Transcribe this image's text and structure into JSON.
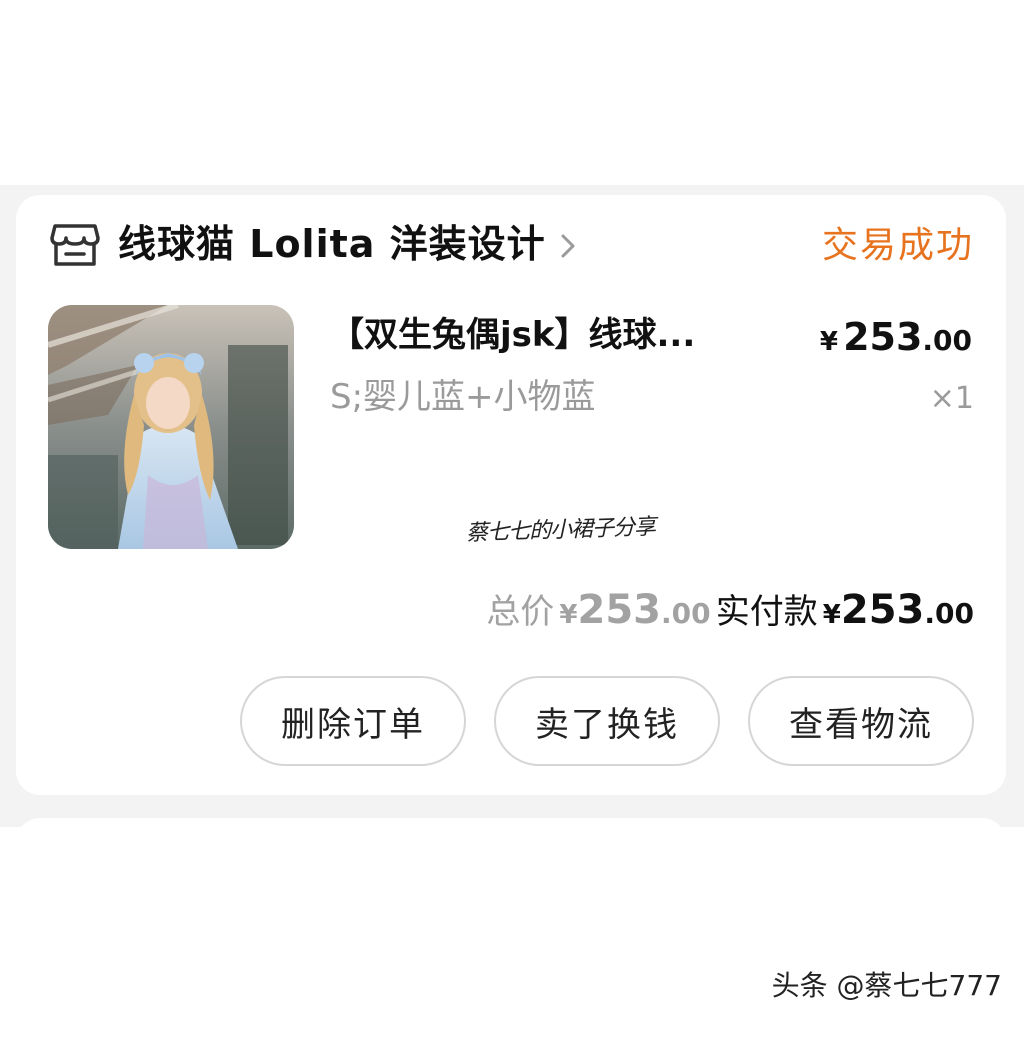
{
  "order": {
    "shop_name": "线球猫 Lolita 洋装设计",
    "status": "交易成功",
    "product": {
      "title": "【双生兔偶jsk】线球...",
      "sku": "S;婴儿蓝+小物蓝",
      "price_symbol": "¥",
      "price_int": "253",
      "price_dec": ".00",
      "quantity": "×1"
    },
    "totals": {
      "total_label": "总价",
      "total_symbol": "¥",
      "total_int": "253",
      "total_dec": ".00",
      "paid_label": "实付款",
      "paid_symbol": "¥",
      "paid_int": "253",
      "paid_dec": ".00"
    },
    "actions": {
      "delete_label": "删除订单",
      "sell_label": "卖了换钱",
      "logistics_label": "查看物流"
    }
  },
  "watermarks": {
    "center": "蔡七七的小裙子分享",
    "footer": "头条 @蔡七七777"
  },
  "colors": {
    "status": "#e8731f",
    "text": "#111111",
    "muted": "#9a9a9a",
    "border": "#d6d6d6",
    "page_bg": "#f3f3f3"
  },
  "icons": {
    "shop": "store-icon",
    "chevron": "chevron-right-icon"
  }
}
